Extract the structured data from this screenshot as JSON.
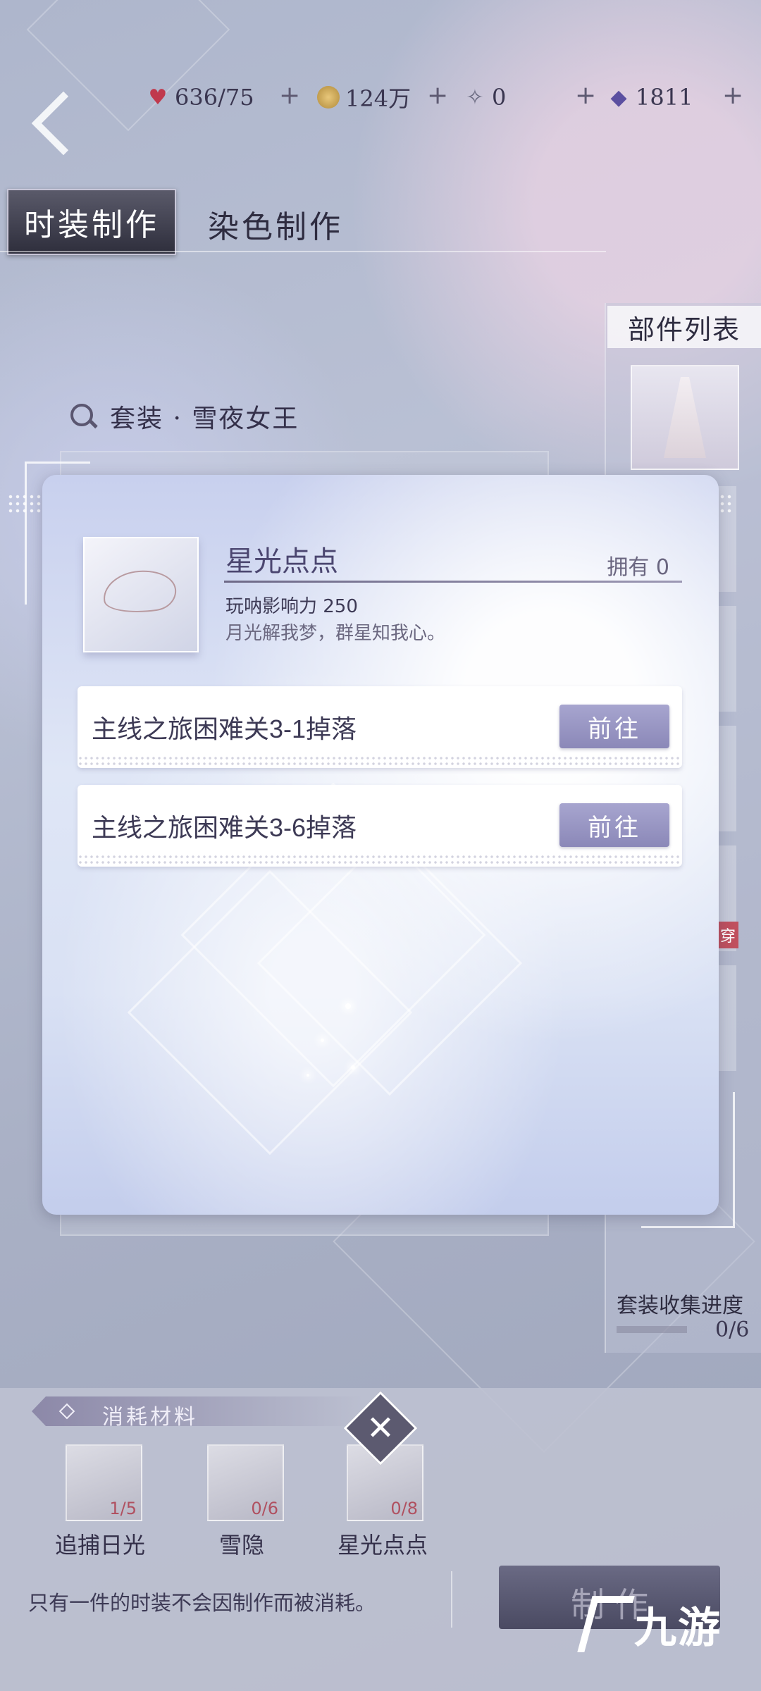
{
  "currencies": [
    {
      "icon": "heart-gem-icon",
      "value": "636/75"
    },
    {
      "icon": "gold-coin-icon",
      "value": "124万"
    },
    {
      "icon": "crystal-icon",
      "value": "0"
    },
    {
      "icon": "diamond-icon",
      "value": "1811"
    }
  ],
  "tabs": {
    "active": "时装制作",
    "inactive": "染色制作"
  },
  "search": {
    "text": "套装 · 雪夜女王"
  },
  "parts": {
    "title": "部件列表",
    "tag": "穿"
  },
  "collection": {
    "label": "套装收集进度",
    "value": "0/6"
  },
  "modal": {
    "item_name": "星光点点",
    "owned": "拥有 0",
    "influence": "玩呐影响力  250",
    "description": "月光解我梦，群星知我心。",
    "sources": [
      {
        "label": "主线之旅困难关3-1掉落",
        "button": "前往"
      },
      {
        "label": "主线之旅困难关3-6掉落",
        "button": "前往"
      }
    ]
  },
  "materials": {
    "title": "消耗材料",
    "items": [
      {
        "name": "追捕日光",
        "count": "1/5"
      },
      {
        "name": "雪隐",
        "count": "0/6"
      },
      {
        "name": "星光点点",
        "count": "0/8"
      }
    ]
  },
  "footer": {
    "note": "只有一件的时装不会因制作而被消耗。",
    "make_button": "制作",
    "watermark": "九游"
  }
}
